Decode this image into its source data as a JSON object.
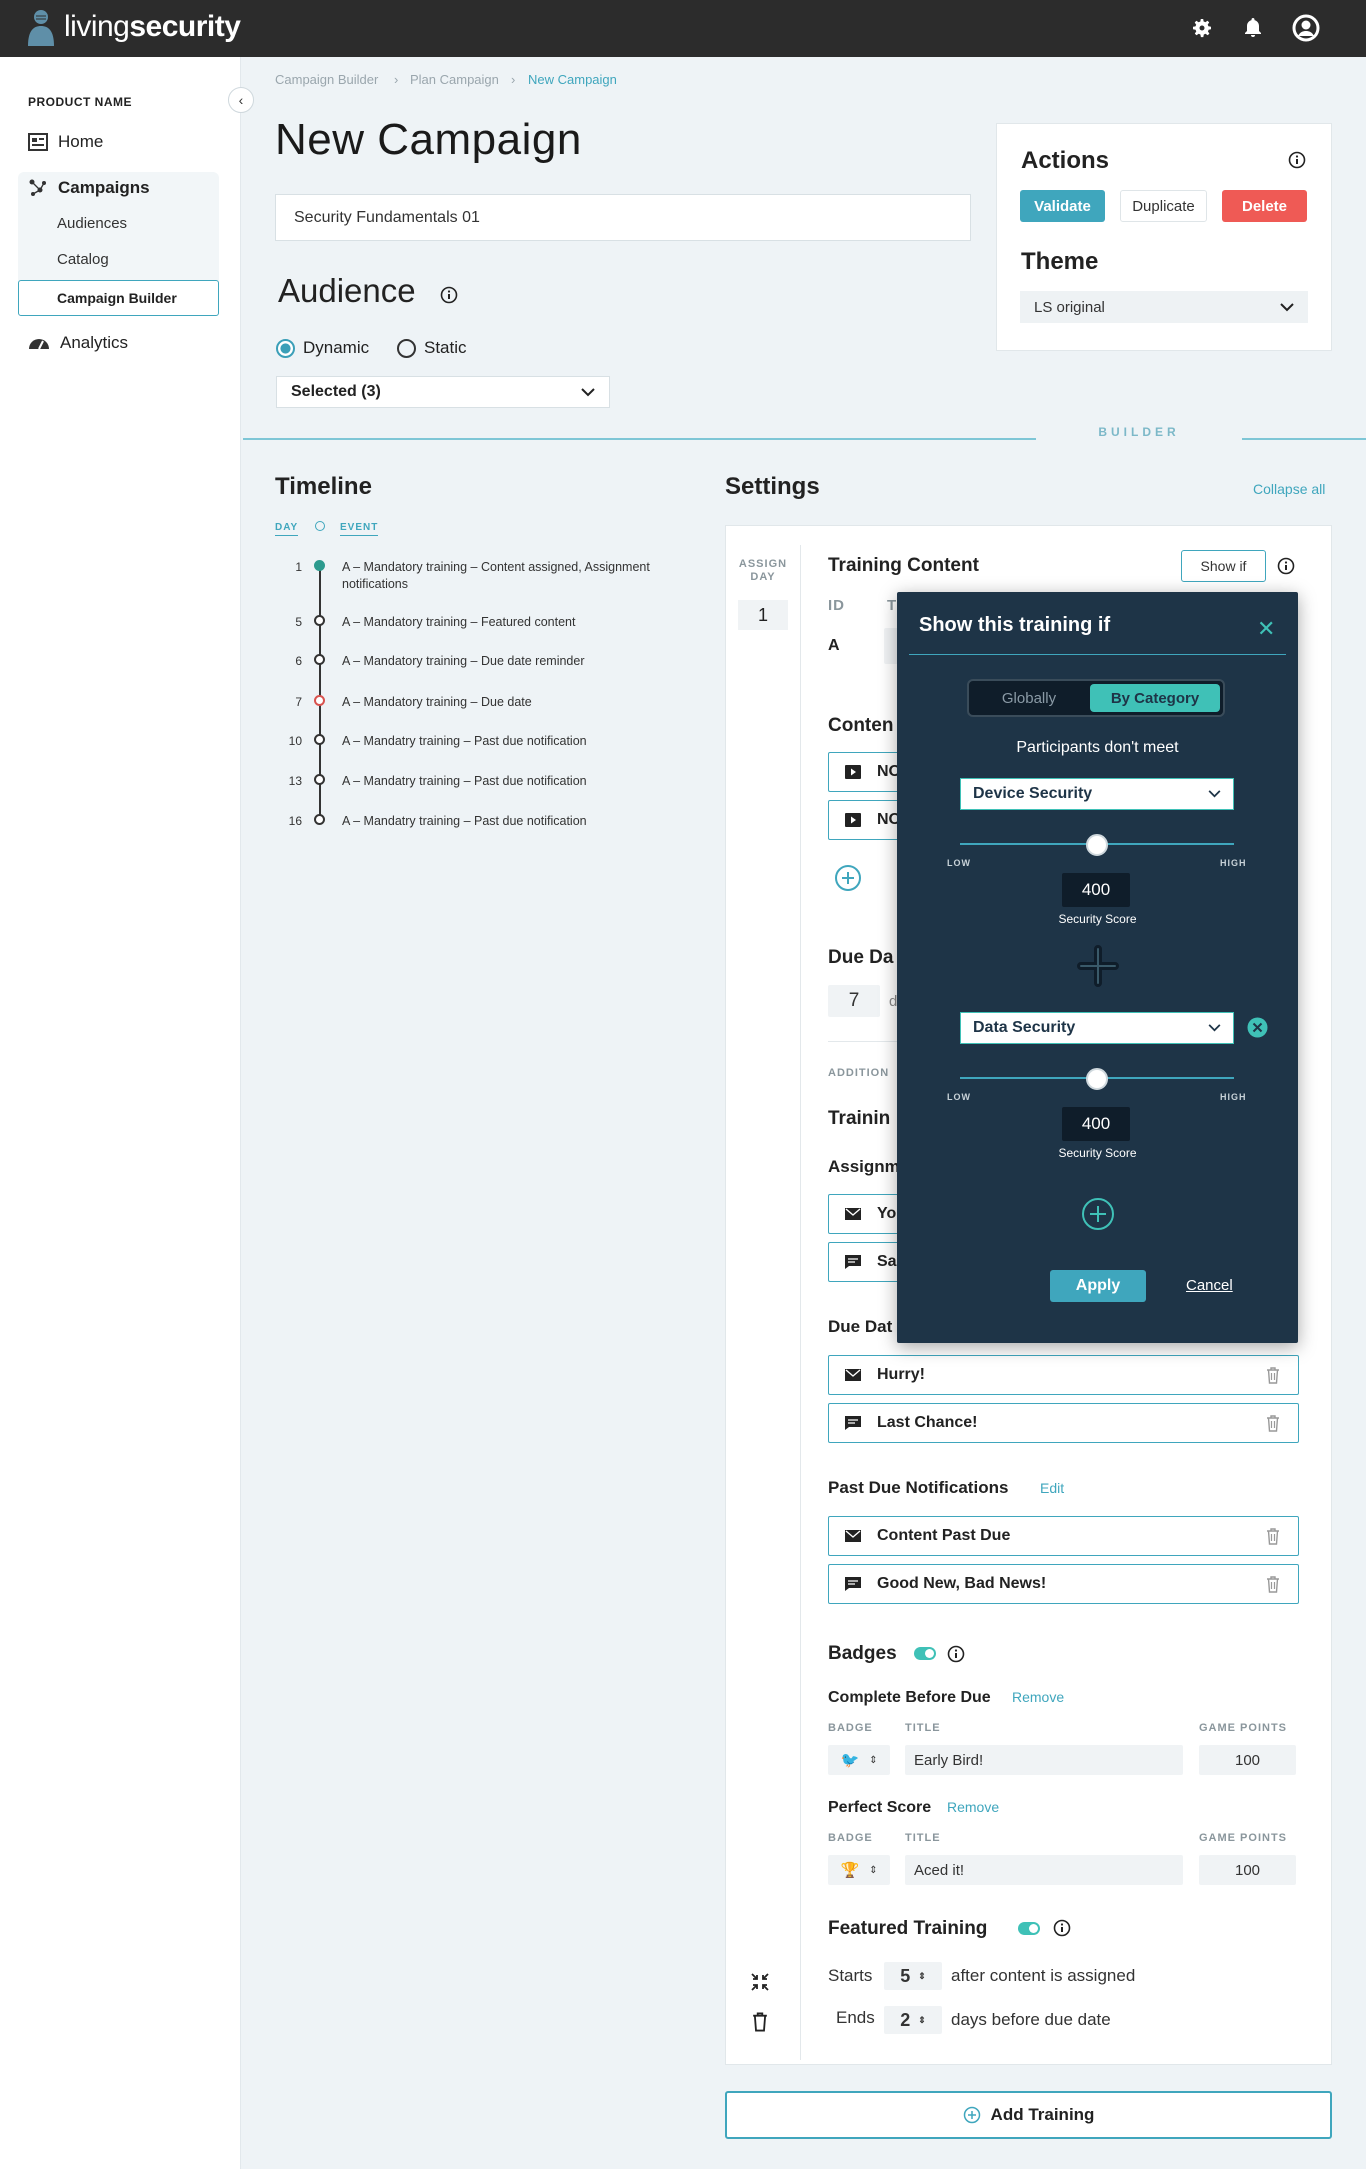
{
  "topbar": {
    "logo_light": "living",
    "logo_bold": "security"
  },
  "sidebar": {
    "product_name": "PRODUCT NAME",
    "home": "Home",
    "campaigns": "Campaigns",
    "audiences": "Audiences",
    "catalog": "Catalog",
    "campaign_builder": "Campaign Builder",
    "analytics": "Analytics"
  },
  "breadcrumb": [
    "Campaign Builder",
    "Plan Campaign",
    "New Campaign"
  ],
  "page": {
    "title": "New Campaign",
    "campaign_name": "Security Fundamentals 01"
  },
  "audience": {
    "title": "Audience",
    "dynamic": "Dynamic",
    "static": "Static",
    "selected": "Selected (3)"
  },
  "actions": {
    "title": "Actions",
    "validate": "Validate",
    "duplicate": "Duplicate",
    "delete": "Delete",
    "theme_title": "Theme",
    "theme_value": "LS original"
  },
  "builder_tab": "BUILDER",
  "timeline": {
    "title": "Timeline",
    "day_label": "DAY",
    "event_label": "EVENT",
    "events": [
      {
        "day": "1",
        "text": "A – Mandatory training – Content assigned, Assignment notifications",
        "color": "#2c9a8e"
      },
      {
        "day": "5",
        "text": "A – Mandatory training – Featured content",
        "color": "#333"
      },
      {
        "day": "6",
        "text": "A – Mandatory training – Due date reminder",
        "color": "#333"
      },
      {
        "day": "7",
        "text": "A – Mandatory training – Due date",
        "color": "#d9534f"
      },
      {
        "day": "10",
        "text": "A – Mandatry training – Past due notification",
        "color": "#333"
      },
      {
        "day": "13",
        "text": "A – Mandatry training – Past due notification",
        "color": "#333"
      },
      {
        "day": "16",
        "text": "A – Mandatry training – Past due notification",
        "color": "#333"
      }
    ]
  },
  "settings": {
    "title": "Settings",
    "collapse_all": "Collapse all",
    "assign_day_label": "ASSIGN DAY",
    "assign_day": "1",
    "training_content": "Training Content",
    "show_if": "Show if",
    "id_label": "ID",
    "t_label": "T",
    "id_value": "A",
    "content_label": "Conten",
    "content_items": [
      "NO",
      "NO"
    ],
    "due_date_label": "Due Da",
    "due_value": "7",
    "due_unit": "d",
    "additional": "ADDITION",
    "training_notif": "Trainin",
    "assignment": "Assignm",
    "assign_items": [
      "Yo",
      "Sa"
    ],
    "due_date_notif": "Due Dat",
    "due_items": [
      "Hurry!",
      "Last Chance!"
    ],
    "past_due": "Past Due Notifications",
    "past_due_edit": "Edit",
    "past_due_items": [
      "Content Past Due",
      "Good New, Bad News!"
    ],
    "badges": "Badges",
    "badge_groups": [
      {
        "name": "Complete Before Due",
        "remove": "Remove",
        "title": "Early Bird!",
        "points": "100"
      },
      {
        "name": "Perfect Score",
        "remove": "Remove",
        "title": "Aced it!",
        "points": "100"
      }
    ],
    "badge_col": "BADGE",
    "title_col": "TITLE",
    "points_col": "GAME POINTS",
    "featured": "Featured Training",
    "starts": "Starts",
    "starts_val": "5",
    "starts_after": "after content is assigned",
    "ends": "Ends",
    "ends_val": "2",
    "ends_after": "days before due date"
  },
  "add_training": "Add Training",
  "popup": {
    "title": "Show this training if",
    "globally": "Globally",
    "by_category": "By Category",
    "participants": "Participants don't meet",
    "cat1": "Device Security",
    "cat2": "Data Security",
    "low": "LOW",
    "high": "HIGH",
    "score1": "400",
    "score2": "400",
    "score_label": "Security Score",
    "apply": "Apply",
    "cancel": "Cancel",
    "slider1": 0.5,
    "slider2": 0.5
  },
  "colors": {
    "accent": "#3fa6bd",
    "teal": "#3fc1b7",
    "danger": "#ef5a55",
    "popup_bg": "#1e3447",
    "topbar": "#2c2c2c"
  }
}
